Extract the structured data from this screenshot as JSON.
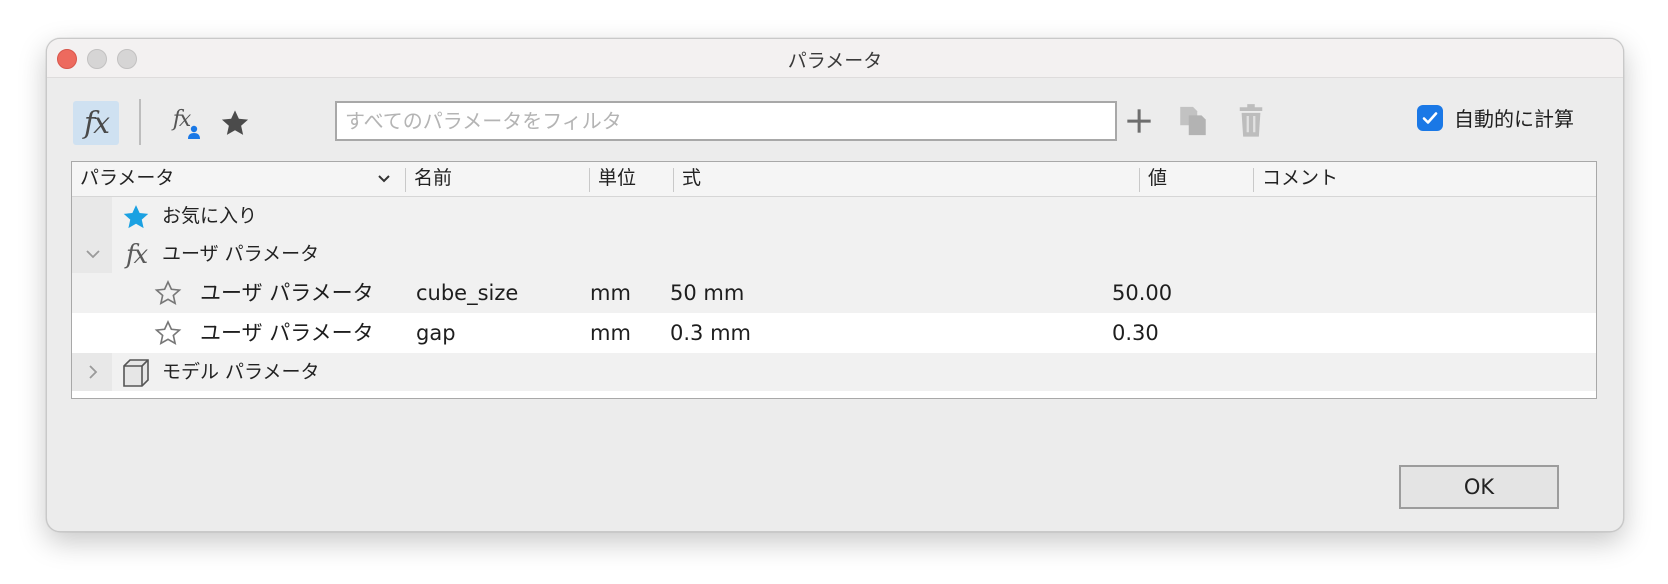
{
  "window": {
    "title": "パラメータ"
  },
  "toolbar": {
    "fx_icon": "fx-icon",
    "fx_glyph": "fx",
    "user_fx_icon": "user-parameter-icon",
    "favorite_icon": "star-icon",
    "filter_placeholder": "すべてのパラメータをフィルタ",
    "filter_value": "",
    "add_icon": "plus-icon",
    "copy_icon": "copy-icon",
    "delete_icon": "trash-icon",
    "auto_calc_label": "自動的に計算",
    "auto_calc_checked": true
  },
  "table": {
    "columns": [
      "パラメータ",
      "名前",
      "単位",
      "式",
      "値",
      "コメント"
    ],
    "groups": {
      "favorites": {
        "label": "お気に入り",
        "icon": "star-filled-icon",
        "color": "#1ba1e2"
      },
      "user": {
        "label": "ユーザ パラメータ",
        "icon": "fx-icon",
        "expanded": true,
        "rows": [
          {
            "param": "ユーザ パラメータ",
            "name": "cube_size",
            "unit": "mm",
            "expr": "50 mm",
            "value": "50.00",
            "comment": ""
          },
          {
            "param": "ユーザ パラメータ",
            "name": "gap",
            "unit": "mm",
            "expr": "0.3 mm",
            "value": "0.30",
            "comment": ""
          }
        ]
      },
      "model": {
        "label": "モデル パラメータ",
        "icon": "cube-icon",
        "expanded": false
      }
    }
  },
  "footer": {
    "ok_label": "OK"
  },
  "colors": {
    "accent": "#1a78e6",
    "fx_selected_bg": "#cfe1f1",
    "close_button": "#ed6a5e"
  }
}
